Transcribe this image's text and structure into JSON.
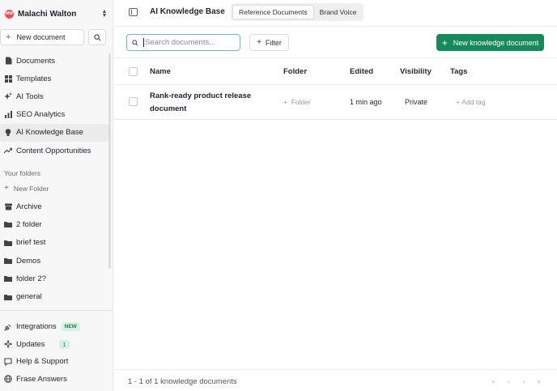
{
  "user": {
    "initials": "MW",
    "name": "Malachi Walton"
  },
  "sidebar": {
    "new_document_label": "New document",
    "nav": [
      {
        "label": "Documents",
        "icon": "document-icon"
      },
      {
        "label": "Templates",
        "icon": "grid-icon"
      },
      {
        "label": "AI Tools",
        "icon": "sparkle-icon"
      },
      {
        "label": "SEO Analytics",
        "icon": "bar-chart-icon"
      },
      {
        "label": "AI Knowledge Base",
        "icon": "lightbulb-icon",
        "active": true
      },
      {
        "label": "Content Opportunities",
        "icon": "trending-up-icon"
      }
    ],
    "folders_heading": "Your folders",
    "new_folder_label": "New Folder",
    "folders": [
      "Archive",
      "2 folder",
      "brief test",
      "Demos",
      "folder 2?",
      "general"
    ],
    "bottom": [
      {
        "label": "Integrations",
        "badge": "NEW"
      },
      {
        "label": "Updates",
        "badge": "1"
      },
      {
        "label": "Help & Support"
      },
      {
        "label": "Frase Answers"
      }
    ]
  },
  "header": {
    "title": "AI Knowledge Base",
    "tabs": [
      {
        "label": "Reference Documents",
        "active": true
      },
      {
        "label": "Brand Voice",
        "active": false
      }
    ]
  },
  "toolbar": {
    "search_placeholder": "Search documents...",
    "filter_label": "Filter",
    "new_button_label": "New knowledge document"
  },
  "table": {
    "columns": [
      "Name",
      "Folder",
      "Edited",
      "Visibility",
      "Tags"
    ],
    "rows": [
      {
        "name": "Rank-ready product release document",
        "folder": "Folder",
        "edited": "1 min ago",
        "visibility": "Private",
        "tags": "Add tag"
      }
    ]
  },
  "footer": {
    "summary": "1 - 1 of 1 knowledge documents",
    "pager": [
      "«",
      "‹",
      "›",
      "»"
    ]
  },
  "colors": {
    "accent": "#168a5a",
    "avatar": "#e8505b",
    "badge_bg": "#d6f1e3"
  }
}
